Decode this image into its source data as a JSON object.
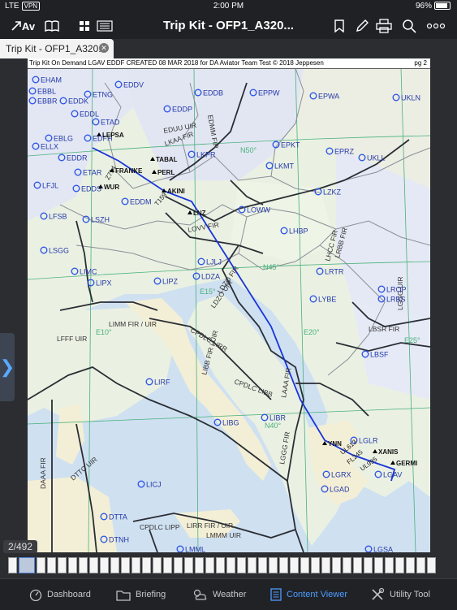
{
  "status": {
    "carrier": "LTE",
    "vpn": "VPN",
    "time": "2:00 PM",
    "battery": "96%"
  },
  "toolbar": {
    "title": "Trip Kit - OFP1_A320...",
    "app_icon": "Av"
  },
  "tab": {
    "label": "Trip Kit - OFP1_A320..."
  },
  "chart": {
    "header": "Trip Kit On Demand LGAV EDDF  CREATED 08 MAR 2018 for DA Aviator Team Test © 2018 Jeppesen",
    "page_label": "pg 2",
    "airports": [
      "EHAM",
      "EBBL",
      "EBBR",
      "EDDK",
      "ETNG",
      "EDDL",
      "ETAD",
      "EDDV",
      "EDDB",
      "EPPW",
      "EPWA",
      "EBLG",
      "EDFH",
      "ELLX",
      "EDDR",
      "ETAR",
      "LFJL",
      "EDDS",
      "EDDM",
      "EDDP",
      "EPKT",
      "EPRZ",
      "UKLL",
      "LKPR",
      "LKMT",
      "LOWW",
      "LZKZ",
      "LFSB",
      "LSZH",
      "LSGG",
      "LHBP",
      "LRTR",
      "LIMC",
      "LIPX",
      "LIPZ",
      "LJLJ",
      "LDZA",
      "LYBE",
      "LROP",
      "LRBS",
      "LBSF",
      "LIRF",
      "LIBR",
      "LIBG",
      "LGLR",
      "LGAV",
      "LGRX",
      "LGAD",
      "LICJ",
      "DTTA",
      "DTNH",
      "LMML",
      "LGSA",
      "UKLN"
    ],
    "fixes": [
      "LEPSA",
      "TABAL",
      "PERL",
      "FRANKE",
      "WUR",
      "AKINI",
      "LNZ",
      "YNN",
      "XANIS",
      "GERMI"
    ],
    "airways": [
      "Z714",
      "T159",
      "UL613",
      "UL995",
      "FL245"
    ],
    "regions": [
      "EDUU UIR",
      "EDMM FIR",
      "LKAA FIR",
      "LOVV FIR",
      "LHCC FIR",
      "LRBB FIR",
      "LDZO FIR",
      "LDZO UIR",
      "LAAA FIR",
      "LIMM FIR / UIR",
      "CPDLC LIRR",
      "LIBB FIR / UIR",
      "CPDLC LIBB",
      "LGGG FIR",
      "LFFF UIR",
      "DTTC UIR",
      "DAAA FIR",
      "CPDLC LIPP",
      "LIRR FIR / UIR",
      "LMMM UIR",
      "LBSR FIR",
      "LGGG UIR"
    ],
    "grid_labels": [
      "N50°",
      "N45°",
      "N40°",
      "E10°",
      "E15°",
      "E20°",
      "E25°"
    ]
  },
  "page_count": "2/492",
  "nav": {
    "items": [
      {
        "label": "Dashboard"
      },
      {
        "label": "Briefing"
      },
      {
        "label": "Weather"
      },
      {
        "label": "Content Viewer"
      },
      {
        "label": "Utility Tool"
      }
    ]
  },
  "colors": {
    "route": "#1a34d8",
    "airport": "#2f56e6",
    "grid": "#49b17a",
    "active_nav": "#4e9cff"
  }
}
